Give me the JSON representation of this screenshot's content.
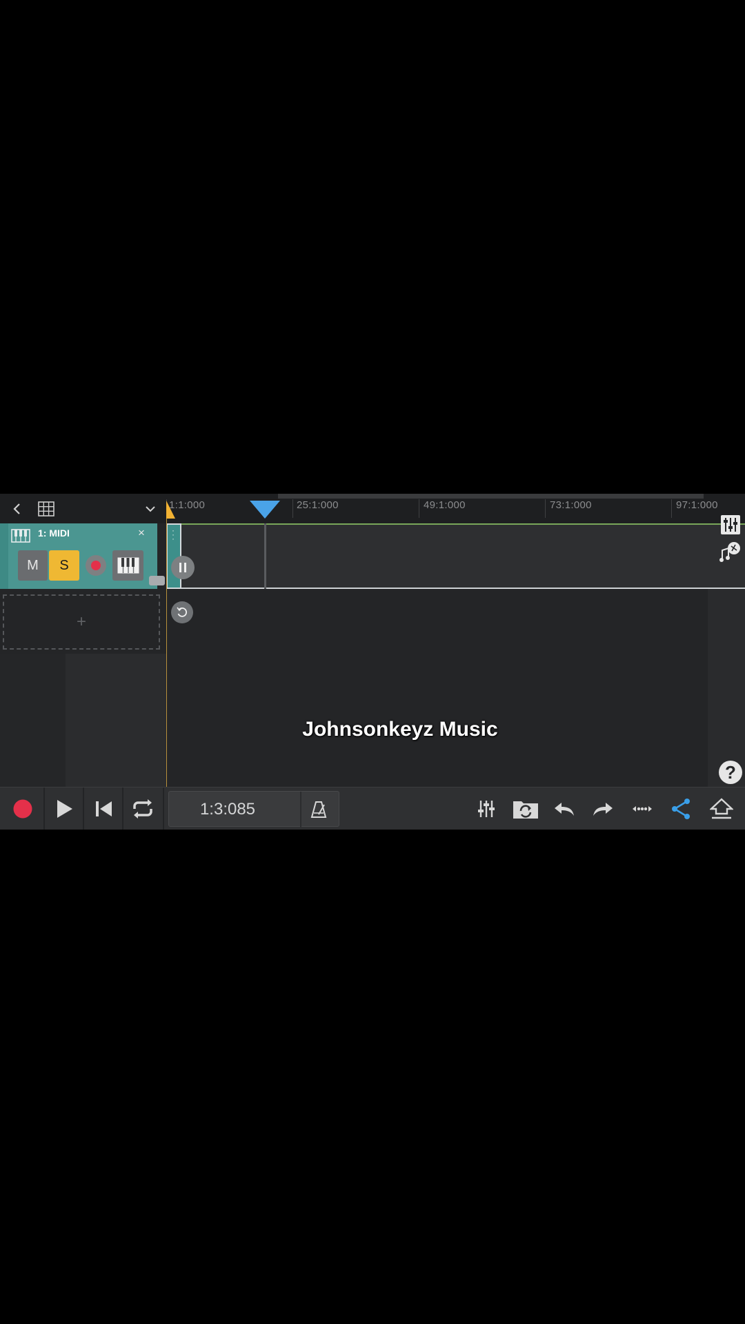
{
  "header": {
    "ruler_labels": [
      "1:1:000",
      "25:1:000",
      "49:1:000",
      "73:1:000",
      "97:1:000"
    ]
  },
  "track": {
    "name": "1: MIDI",
    "close_label": "×",
    "mute_label": "M",
    "solo_label": "S"
  },
  "add_track": {
    "label": "+"
  },
  "overlay": {
    "watermark": "Johnsonkeyz Music"
  },
  "transport": {
    "time": "1:3:085"
  },
  "help": {
    "label": "?"
  },
  "colors": {
    "background": "#242527",
    "track_color": "#4b9691",
    "solo_active": "#efb833",
    "record": "#e4304a",
    "playhead": "#4aa3e8",
    "loop_marker": "#f2b233",
    "share_accent": "#3a9fe9"
  },
  "icons": [
    "back-arrow-icon",
    "grid-icon",
    "chevron-down-icon",
    "piano-keyboard-icon",
    "close-icon",
    "record-arm-icon",
    "instrument-icon",
    "pause-icon",
    "rewind-circle-icon",
    "mixer-icon",
    "sample-browser-icon",
    "help-icon",
    "record-icon",
    "play-icon",
    "skip-to-start-icon",
    "loop-icon",
    "metronome-icon",
    "folder-sync-icon",
    "undo-icon",
    "redo-icon",
    "more-icon",
    "share-icon",
    "export-icon"
  ]
}
